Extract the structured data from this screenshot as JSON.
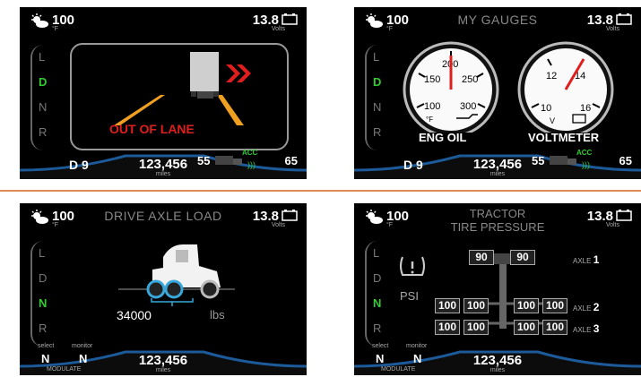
{
  "common": {
    "temp": "100",
    "temp_unit": "°F",
    "volts": "13.8",
    "volts_unit": "Volts",
    "odometer": "123,456",
    "odometer_unit": "miles"
  },
  "gears": [
    "L",
    "D",
    "N",
    "R"
  ],
  "panel1": {
    "active_gear": "D",
    "alert": "OUT OF LANE",
    "drive_gear": "D 9",
    "speed_left": "55",
    "acc": "ACC",
    "speed_right": "65"
  },
  "panel2": {
    "title": "MY GAUGES",
    "active_gear": "D",
    "eng_oil": {
      "label": "ENG OIL",
      "ticks": [
        "100",
        "150",
        "200",
        "250",
        "300"
      ],
      "unit": "°F",
      "value": 200
    },
    "voltmeter": {
      "label": "VOLTMETER",
      "ticks": [
        "10",
        "12",
        "14",
        "16"
      ],
      "unit": "V",
      "value": 14
    },
    "drive_gear": "D 9",
    "speed_left": "55",
    "acc": "ACC",
    "speed_right": "65"
  },
  "panel3": {
    "title": "DRIVE AXLE LOAD",
    "active_gear": "N",
    "load_value": "34000",
    "load_unit": "lbs",
    "select_label": "select",
    "monitor_label": "monitor",
    "select_value": "N",
    "monitor_value": "N",
    "modulate": "MODULATE"
  },
  "panel4": {
    "title_line1": "TRACTOR",
    "title_line2": "TIRE PRESSURE",
    "active_gear": "N",
    "psi": "PSI",
    "axle_prefix": "AXLE",
    "axle1": {
      "num": "1",
      "left": "90",
      "right": "90"
    },
    "axle2": {
      "num": "2",
      "values": [
        "100",
        "100",
        "100",
        "100"
      ]
    },
    "axle3": {
      "num": "3",
      "values": [
        "100",
        "100",
        "100",
        "100"
      ]
    },
    "select_label": "select",
    "monitor_label": "monitor",
    "select_value": "N",
    "monitor_value": "N",
    "modulate": "MODULATE"
  },
  "colors": {
    "accent_green": "#33cc33",
    "alert_red": "#e01e1e",
    "lane_orange": "#f0a020",
    "divider": "#e08a55",
    "bottom_blue": "#1c5a9a"
  }
}
